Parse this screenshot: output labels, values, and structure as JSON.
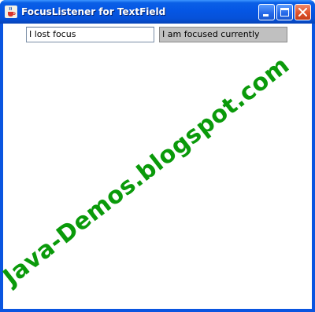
{
  "window": {
    "title": "FocusListener for TextField",
    "app_icon": "java-cup-icon",
    "controls": [
      "minimize-icon",
      "maximize-icon",
      "close-icon"
    ]
  },
  "fields": {
    "left_value": "I lost focus",
    "right_value": "I am focused currently"
  },
  "watermark": {
    "text": "Java-Demos.blogspot.com"
  },
  "colors": {
    "titlebar": "#0556e4",
    "close_button": "#e0532b",
    "watermark": "#0a9a0a",
    "focused_field_bg": "#c0c0c0"
  }
}
